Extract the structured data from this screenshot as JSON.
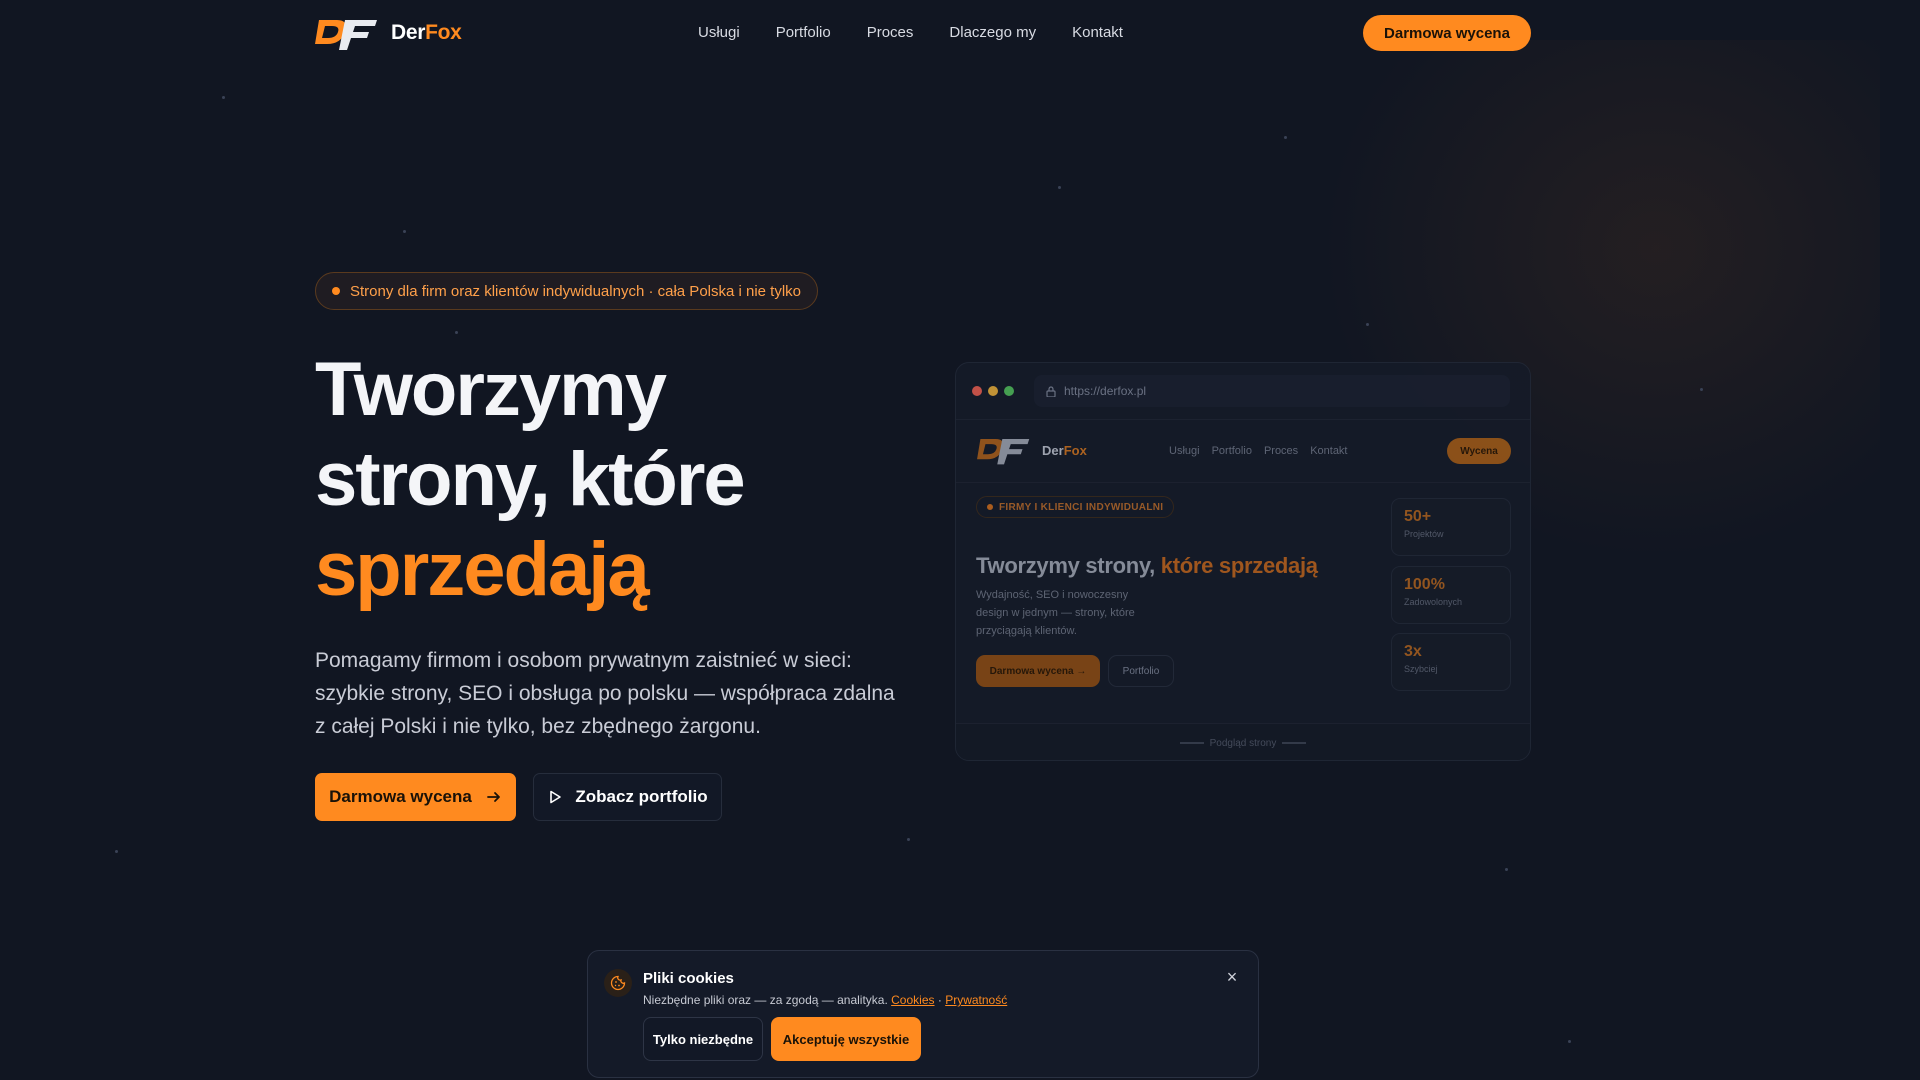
{
  "nav": {
    "brand_prefix": "Der",
    "brand_suffix": "Fox",
    "links": [
      "Usługi",
      "Portfolio",
      "Proces",
      "Dlaczego my",
      "Kontakt"
    ],
    "cta": "Darmowa wycena"
  },
  "hero": {
    "badge": "Strony dla firm oraz klientów indywidualnych · cała Polska i nie tylko",
    "headline_line1": "Tworzymy",
    "headline_line2": "strony, które",
    "headline_accent": "sprzedają",
    "lead": "Pomagamy firmom i osobom prywatnym zaistnieć w sieci: szybkie strony, SEO i obsługa po polsku — współpraca zdalna z całej Polski i nie tylko, bez zbędnego żargonu.",
    "primary_button": "Darmowa wycena",
    "secondary_button": "Zobacz portfolio"
  },
  "mockup": {
    "url": "https://derfox.pl",
    "brand_prefix": "Der",
    "brand_suffix": "Fox",
    "nav_links": [
      "Usługi",
      "Portfolio",
      "Proces",
      "Kontakt"
    ],
    "cta": "Wycena",
    "badge": "FIRMY I KLIENCI INDYWIDUALNI",
    "title": "Tworzymy strony,",
    "title_accent": "które sprzedają",
    "description": "Wydajność, SEO i nowoczesny design w jednym — strony, które przyciągają klientów.",
    "button_primary": "Darmowa wycena →",
    "button_secondary": "Portfolio",
    "stats": [
      {
        "value": "50+",
        "label": "Projektów"
      },
      {
        "value": "100%",
        "label": "Zadowolonych"
      },
      {
        "value": "3x",
        "label": "Szybciej"
      }
    ],
    "footer": "Podgląd strony"
  },
  "cookie": {
    "title": "Pliki cookies",
    "text": "Niezbędne pliki oraz — za zgodą — analityka.",
    "link_cookies": "Cookies",
    "separator": "·",
    "link_privacy": "Prywatność",
    "btn_essential": "Tylko niezbędne",
    "btn_accept": "Akceptuję wszystkie",
    "close": "×"
  },
  "colors": {
    "accent": "#ff8a1f",
    "background": "#111622"
  }
}
